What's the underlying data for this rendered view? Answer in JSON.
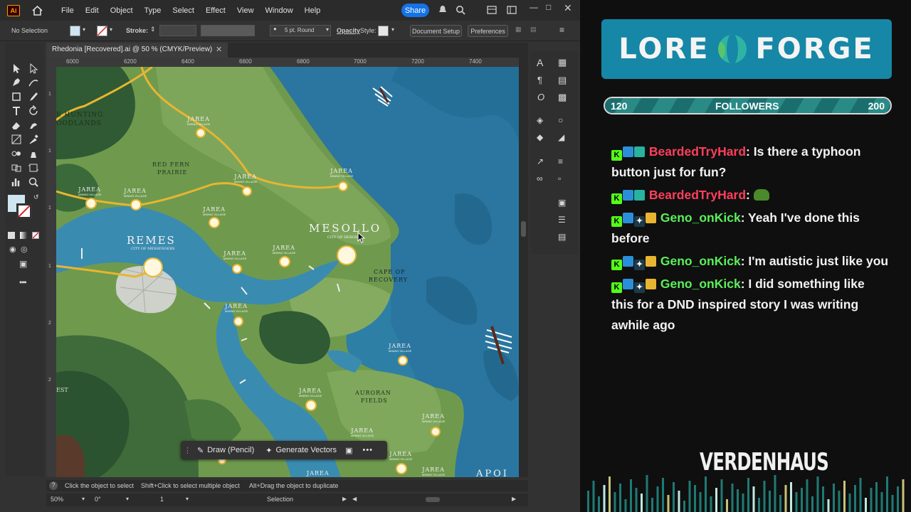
{
  "app": {
    "logo": "Ai",
    "menus": [
      "File",
      "Edit",
      "Object",
      "Type",
      "Select",
      "Effect",
      "View",
      "Window",
      "Help"
    ],
    "share_label": "Share",
    "control": {
      "selection": "No Selection",
      "stroke_label": "Stroke:",
      "brush": "5 pt. Round",
      "opacity_label": "Opacity",
      "style_label": "Style:",
      "document_setup": "Document Setup",
      "preferences": "Preferences"
    },
    "document_tab": "Rhedonia [Recovered].ai @ 50 % (CMYK/Preview)",
    "ruler_top": [
      "6000",
      "6200",
      "6400",
      "6600",
      "6800",
      "7000",
      "7200",
      "7400"
    ],
    "ruler_left": [
      "1",
      "1",
      "1",
      "1",
      "1",
      "2",
      "2",
      "2",
      "2"
    ],
    "context_bar": {
      "draw": "Draw (Pencil)",
      "generate": "Generate Vectors"
    },
    "hint": {
      "a": "Click the object to select",
      "b": "Shift+Click to select multiple object",
      "c": "Alt+Drag the object to duplicate"
    },
    "status": {
      "zoom": "50%",
      "rotation": "0°",
      "artboard": "1",
      "tool": "Selection"
    }
  },
  "map": {
    "labels": {
      "hunting": "E HUNTING",
      "hunting2": "OODLANDS",
      "red_fern": "RED FERN",
      "prairie": "PRAIRIE",
      "remes": "REMES",
      "remes_sub": "CITY OF MESSENGERS",
      "mesollo": "MESOLLO",
      "mesollo_sub": "CITY OF HEROES",
      "cape": "CAPE OF",
      "recovery": "RECOVERY",
      "auroran": "AURORAN",
      "fields": "FIELDS",
      "jarea": "JAREA",
      "mining": "MINING VILLAGE",
      "apoi": "APOI",
      "rest": "EST"
    }
  },
  "overlay": {
    "logo_left": "LORE",
    "logo_right": "FORGE",
    "followers_min": "120",
    "followers_label": "FOLLOWERS",
    "followers_max": "200",
    "followers_progress": 1.0,
    "chat": [
      {
        "user": "BeardedTryHard",
        "text": ": Is there a typhoon button just for fun?"
      },
      {
        "user": "BeardedTryHard",
        "text": ": "
      },
      {
        "user": "Geno_onKick",
        "text": ": Yeah I've done this before"
      },
      {
        "user": "Geno_onKick",
        "text": ": I'm autistic just like you"
      },
      {
        "user": "Geno_onKick",
        "text": ": I did something like this for a DND inspired story I was writing awhile ago"
      }
    ],
    "brand": "VERDENHAUS"
  },
  "colors": {
    "ocean": "#2e7fa5",
    "land": "#6f9a4e",
    "forest": "#2f5a33",
    "road": "#e8b531",
    "accent_blue": "#1473e6",
    "user_red": "#ff3f5c",
    "user_green": "#5af05a"
  }
}
